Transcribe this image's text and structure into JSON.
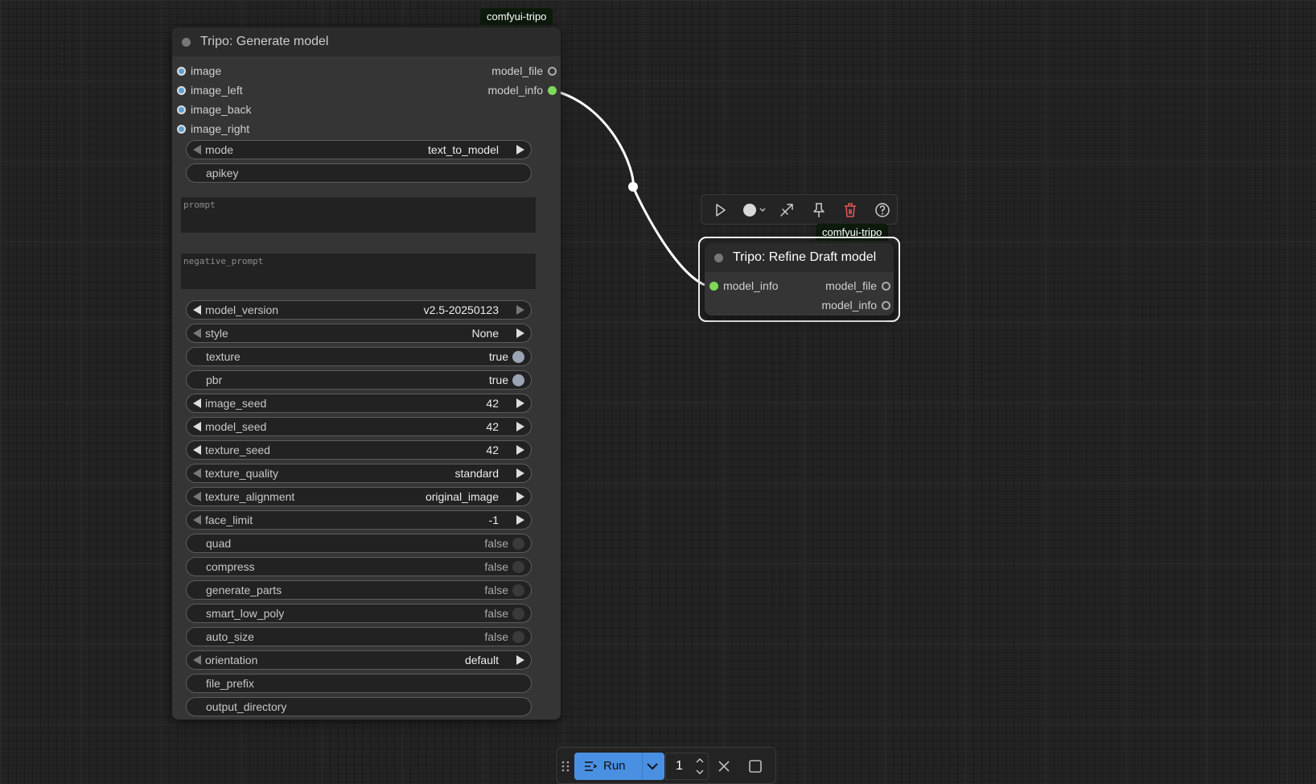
{
  "nodes": {
    "generate": {
      "badge": "comfyui-tripo",
      "title": "Tripo: Generate model",
      "inputs": [
        "image",
        "image_left",
        "image_back",
        "image_right"
      ],
      "outputs": [
        "model_file",
        "model_info"
      ],
      "mode": {
        "label": "mode",
        "value": "text_to_model"
      },
      "apikey": {
        "label": "apikey"
      },
      "prompt": {
        "placeholder": "prompt"
      },
      "negative_prompt": {
        "placeholder": "negative_prompt"
      },
      "model_version": {
        "label": "model_version",
        "value": "v2.5-20250123"
      },
      "style": {
        "label": "style",
        "value": "None"
      },
      "texture": {
        "label": "texture",
        "value": "true"
      },
      "pbr": {
        "label": "pbr",
        "value": "true"
      },
      "image_seed": {
        "label": "image_seed",
        "value": "42"
      },
      "model_seed": {
        "label": "model_seed",
        "value": "42"
      },
      "texture_seed": {
        "label": "texture_seed",
        "value": "42"
      },
      "texture_quality": {
        "label": "texture_quality",
        "value": "standard"
      },
      "texture_alignment": {
        "label": "texture_alignment",
        "value": "original_image"
      },
      "face_limit": {
        "label": "face_limit",
        "value": "-1"
      },
      "quad": {
        "label": "quad",
        "value": "false"
      },
      "compress": {
        "label": "compress",
        "value": "false"
      },
      "generate_parts": {
        "label": "generate_parts",
        "value": "false"
      },
      "smart_low_poly": {
        "label": "smart_low_poly",
        "value": "false"
      },
      "auto_size": {
        "label": "auto_size",
        "value": "false"
      },
      "orientation": {
        "label": "orientation",
        "value": "default"
      },
      "file_prefix": {
        "label": "file_prefix"
      },
      "output_directory": {
        "label": "output_directory"
      }
    },
    "refine": {
      "badge": "comfyui-tripo",
      "title": "Tripo: Refine Draft model",
      "inputs": [
        "model_info"
      ],
      "outputs": [
        "model_file",
        "model_info"
      ]
    }
  },
  "selection_toolbar": {
    "icons": [
      "play-icon",
      "color-circle-icon",
      "bypass-icon",
      "pin-icon",
      "trash-icon",
      "help-icon"
    ]
  },
  "run_bar": {
    "run_label": "Run",
    "queue_count": "1"
  },
  "colors": {
    "canvas": "#232323",
    "node": "#353535",
    "node_title": "#2b2b2b",
    "model_info_link": "#7ed957",
    "run_button": "#4a90e2",
    "trash": "#e05555"
  }
}
